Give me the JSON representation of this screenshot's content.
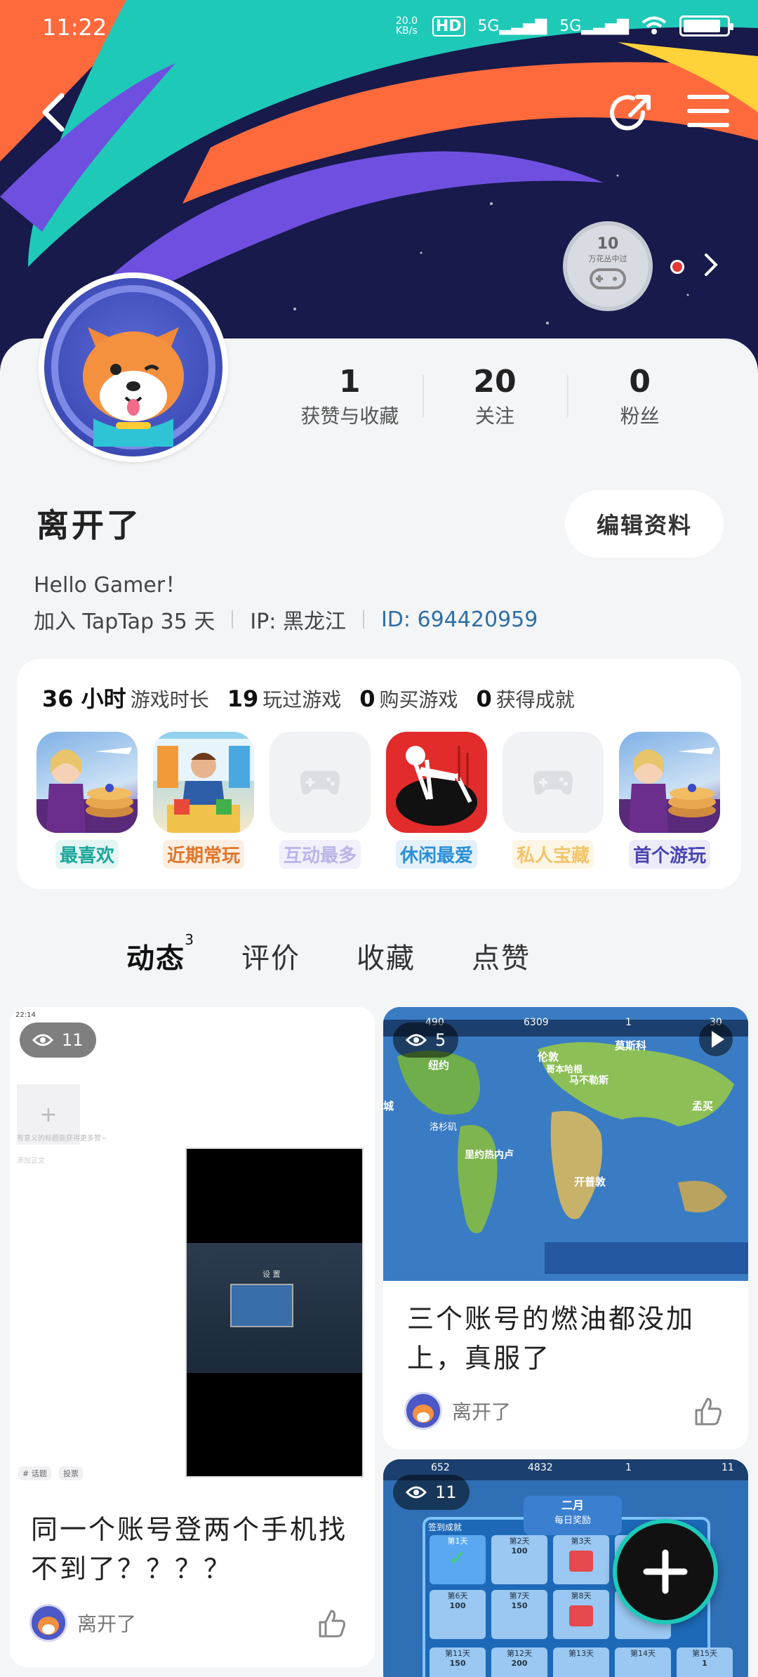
{
  "status": {
    "time": "11:22",
    "speed": "20.0\nKB/s",
    "net1": "5G",
    "net2": "5G",
    "hd": "HD"
  },
  "badge": {
    "number": "10",
    "caption": "万花丛中过"
  },
  "stats": [
    {
      "value": "1",
      "label": "获赞与收藏"
    },
    {
      "value": "20",
      "label": "关注"
    },
    {
      "value": "0",
      "label": "粉丝"
    }
  ],
  "profile": {
    "name": "离开了",
    "edit_label": "编辑资料",
    "bio": "Hello Gamer！",
    "joined": "加入 TapTap 35 天",
    "ip": "IP: 黑龙江",
    "id": "ID: 694420959"
  },
  "game_stats": {
    "hours_value": "36 小时",
    "hours_label": "游戏时长",
    "played_value": "19",
    "played_label": "玩过游戏",
    "bought_value": "0",
    "bought_label": "购买游戏",
    "achieve_value": "0",
    "achieve_label": "获得成就"
  },
  "games": [
    {
      "label": "最喜欢",
      "color": "#1aa79a",
      "bg": "#e3f6f3",
      "icon": "airline-chef-game-icon"
    },
    {
      "label": "近期常玩",
      "color": "#e0762a",
      "bg": "#fdeee2",
      "icon": "supermarket-game-icon"
    },
    {
      "label": "互动最多",
      "color": "#b9b5e8",
      "bg": "#f1f0fb",
      "icon": "gamepad-placeholder-icon"
    },
    {
      "label": "休闲最爱",
      "color": "#2a8fd6",
      "bg": "#e4f1fb",
      "icon": "hole-game-icon"
    },
    {
      "label": "私人宝藏",
      "color": "#f2c46a",
      "bg": "#fdf6e6",
      "icon": "gamepad-placeholder-icon"
    },
    {
      "label": "首个游玩",
      "color": "#4a45b0",
      "bg": "#ecebf8",
      "icon": "airline-chef-game-icon"
    }
  ],
  "tabs": [
    {
      "label": "动态",
      "count": "3"
    },
    {
      "label": "评价"
    },
    {
      "label": "收藏"
    },
    {
      "label": "点赞"
    }
  ],
  "posts": [
    {
      "views": "11",
      "title": "同一个账号登两个手机找不到了？？？？",
      "author": "离开了",
      "shot": {
        "time": "22:14",
        "placeholder1": "有意义的标题能获得更多赞~",
        "placeholder2": "添加正文",
        "tag1": "# 话题",
        "tag2": "投票",
        "dialog": "设 置"
      }
    },
    {
      "views": "5",
      "title": "三个账号的燃油都没加上，真服了",
      "author": "离开了",
      "map": {
        "s1": "490",
        "s2": "6309",
        "s3": "1",
        "s4": "30",
        "c1": "纽约",
        "c2": "伦敦",
        "c3": "哥本哈根",
        "c4": "洛杉矶",
        "c5": "孟买",
        "c6": "里约热内卢",
        "c7": "开普敦",
        "c8": "莫斯科",
        "c9": "马不勒斯",
        "c10": "城"
      }
    },
    {
      "views": "11",
      "popup_title": "二月",
      "popup_sub": "每日奖励",
      "left_label": "签到成就",
      "top": {
        "s1": "652",
        "s2": "4832",
        "s3": "1",
        "s4": "11"
      },
      "days": [
        {
          "day": "第1天",
          "val": ""
        },
        {
          "day": "第2天",
          "val": "100"
        },
        {
          "day": "第3天",
          "val": ""
        },
        {
          "day": "第6天",
          "val": "100"
        },
        {
          "day": "第7天",
          "val": "150"
        },
        {
          "day": "第8天",
          "val": ""
        },
        {
          "day": "第11天",
          "val": "150"
        },
        {
          "day": "第12天",
          "val": "200"
        },
        {
          "day": "第13天",
          "val": ""
        },
        {
          "day": "第14天",
          "val": ""
        },
        {
          "day": "第15天",
          "val": "1"
        }
      ]
    }
  ],
  "colors": {
    "accent": "#1fc9b8",
    "banner": "#171a4a"
  }
}
